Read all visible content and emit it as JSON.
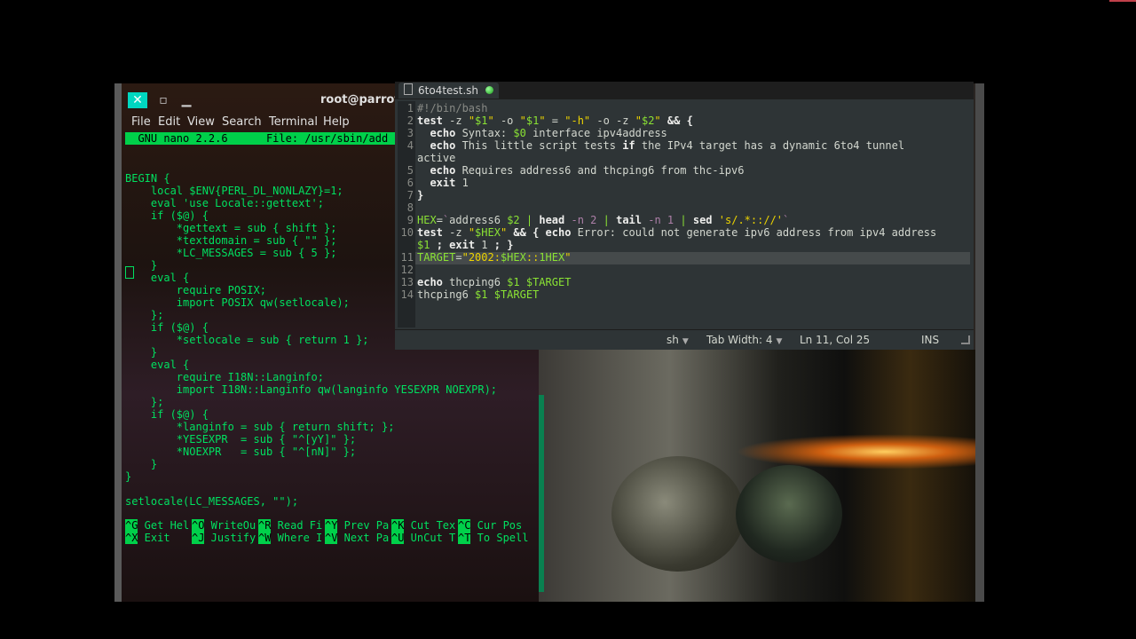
{
  "terminal": {
    "title": "root@parrot",
    "buttons": {
      "close": "✕",
      "min": "▫",
      "max": "▁"
    },
    "menu": [
      "File",
      "Edit",
      "View",
      "Search",
      "Terminal",
      "Help"
    ],
    "nano_header": "  GNU nano 2.2.6      File: /usr/sbin/add",
    "code": [
      "BEGIN {",
      "    local $ENV{PERL_DL_NONLAZY}=1;",
      "    eval 'use Locale::gettext';",
      "    if ($@) {",
      "        *gettext = sub { shift };",
      "        *textdomain = sub { \"\" };",
      "        *LC_MESSAGES = sub { 5 };",
      "    }",
      "    eval {",
      "        require POSIX;",
      "        import POSIX qw(setlocale);",
      "    };",
      "    if ($@) {",
      "        *setlocale = sub { return 1 };",
      "    }",
      "    eval {",
      "        require I18N::Langinfo;",
      "        import I18N::Langinfo qw(langinfo YESEXPR NOEXPR);",
      "    };",
      "    if ($@) {",
      "        *langinfo = sub { return shift; };",
      "        *YESEXPR  = sub { \"^[yY]\" };",
      "        *NOEXPR   = sub { \"^[nN]\" };",
      "    }",
      "}",
      "",
      "setlocale(LC_MESSAGES, \"\");"
    ],
    "shortcuts_row1": [
      {
        "key": "^G",
        "label": " Get Hel"
      },
      {
        "key": "^O",
        "label": " WriteOu"
      },
      {
        "key": "^R",
        "label": " Read Fi"
      },
      {
        "key": "^Y",
        "label": " Prev Pa"
      },
      {
        "key": "^K",
        "label": " Cut Tex"
      },
      {
        "key": "^C",
        "label": " Cur Pos"
      }
    ],
    "shortcuts_row2": [
      {
        "key": "^X",
        "label": " Exit   "
      },
      {
        "key": "^J",
        "label": " Justify"
      },
      {
        "key": "^W",
        "label": " Where I"
      },
      {
        "key": "^V",
        "label": " Next Pa"
      },
      {
        "key": "^U",
        "label": " UnCut T"
      },
      {
        "key": "^T",
        "label": " To Spell"
      }
    ]
  },
  "gedit": {
    "tab_label": "6to4test.sh",
    "line_numbers": [
      "1",
      "2",
      "3",
      "4",
      "",
      "5",
      "6",
      "7",
      "8",
      "9",
      "10",
      "",
      "11",
      "12",
      "13",
      "14"
    ],
    "status": {
      "language": "sh",
      "tab_width": "Tab Width: 4",
      "position": "Ln 11, Col 25",
      "mode": "INS"
    }
  },
  "colors": {
    "nano_green": "#00d04a",
    "terminal_text": "#00e060",
    "gedit_bg": "#2e3436",
    "string_yellow": "#edd400",
    "variable_green": "#8ae234"
  }
}
